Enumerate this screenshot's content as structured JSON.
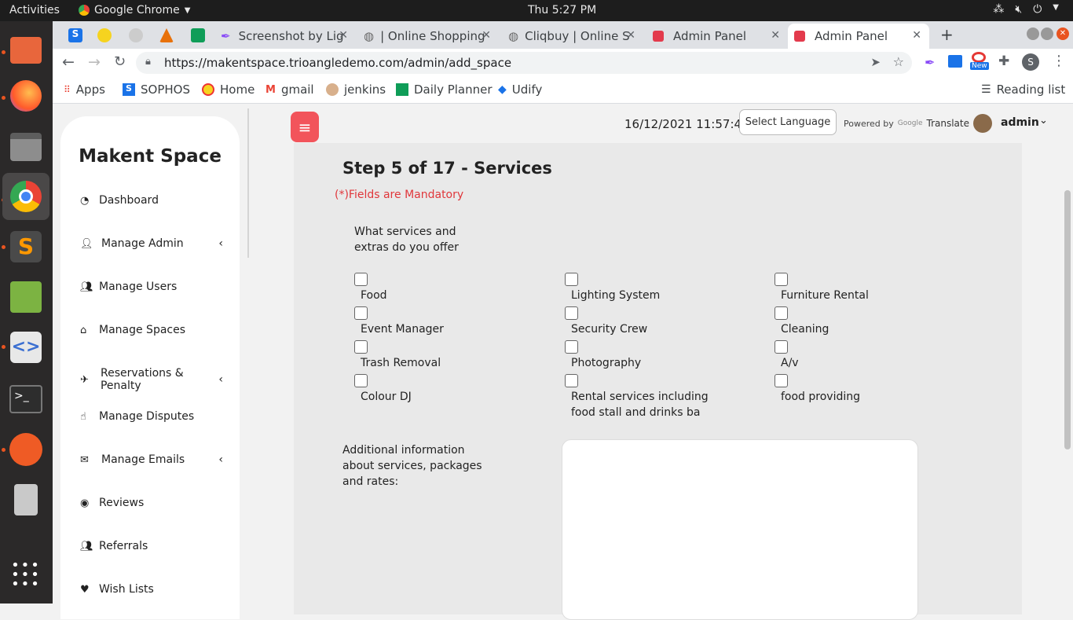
{
  "system": {
    "activities": "Activities",
    "app_name": "Google Chrome",
    "clock": "Thu  5:27 PM"
  },
  "tabs": [
    {
      "label": "Screenshot by Lig",
      "icon": "feather-icon"
    },
    {
      "label": "| Online Shopping",
      "icon": "globe-icon"
    },
    {
      "label": "Cliqbuy | Online S",
      "icon": "globe-icon"
    },
    {
      "label": "Admin Panel",
      "icon": "bookmark-red-icon"
    },
    {
      "label": "Admin Panel",
      "icon": "bookmark-red-icon"
    }
  ],
  "address": {
    "url": "https://makentspace.trioangledemo.com/admin/add_space"
  },
  "bookmarks": [
    {
      "label": "Apps"
    },
    {
      "label": "SOPHOS"
    },
    {
      "label": "Home"
    },
    {
      "label": "gmail"
    },
    {
      "label": "jenkins"
    },
    {
      "label": "Daily Planner"
    },
    {
      "label": "Udify"
    }
  ],
  "reading_list": "Reading list",
  "profile_letter": "S",
  "new_badge": "New",
  "sidebar": {
    "brand": "Makent Space",
    "items": [
      {
        "label": "Dashboard",
        "icon": "dashboard-icon",
        "chevron": false
      },
      {
        "label": "Manage Admin",
        "icon": "user-plus-icon",
        "chevron": true
      },
      {
        "label": "Manage Users",
        "icon": "users-icon",
        "chevron": false
      },
      {
        "label": "Manage Spaces",
        "icon": "home-icon",
        "chevron": false
      },
      {
        "label": "Reservations & Penalty",
        "icon": "plane-icon",
        "chevron": true
      },
      {
        "label": "Manage Disputes",
        "icon": "hand-icon",
        "chevron": false
      },
      {
        "label": "Manage Emails",
        "icon": "envelope-icon",
        "chevron": true
      },
      {
        "label": "Reviews",
        "icon": "eye-icon",
        "chevron": false
      },
      {
        "label": "Referrals",
        "icon": "users-icon",
        "chevron": false
      },
      {
        "label": "Wish Lists",
        "icon": "heart-icon",
        "chevron": false
      }
    ]
  },
  "header": {
    "datetime": "16/12/2021 11:57:46",
    "select_language": "Select Language",
    "powered_by": "Powered by",
    "google": "Google",
    "translate": "Translate",
    "admin": "admin"
  },
  "form": {
    "step_title": "Step 5 of 17 - Services",
    "mandatory": "(*)Fields are Mandatory",
    "services_question": "What services and extras do you offer",
    "services": [
      {
        "label": "Food",
        "checked": false
      },
      {
        "label": "Lighting System",
        "checked": false
      },
      {
        "label": "Furniture Rental",
        "checked": false
      },
      {
        "label": "Event Manager",
        "checked": false
      },
      {
        "label": "Security Crew",
        "checked": false
      },
      {
        "label": "Cleaning",
        "checked": false
      },
      {
        "label": "Trash Removal",
        "checked": false
      },
      {
        "label": "Photography",
        "checked": false
      },
      {
        "label": "A/v",
        "checked": false
      },
      {
        "label": "Colour DJ",
        "checked": false
      },
      {
        "label": "Rental services including food stall and drinks ba",
        "checked": false
      },
      {
        "label": "food providing",
        "checked": false
      }
    ],
    "additional_label": "Additional information about services, packages and rates:",
    "additional_value": ""
  },
  "colors": {
    "accent": "#f2545b",
    "mandatory": "#e0373b",
    "ubuntu_orange": "#e95420"
  }
}
